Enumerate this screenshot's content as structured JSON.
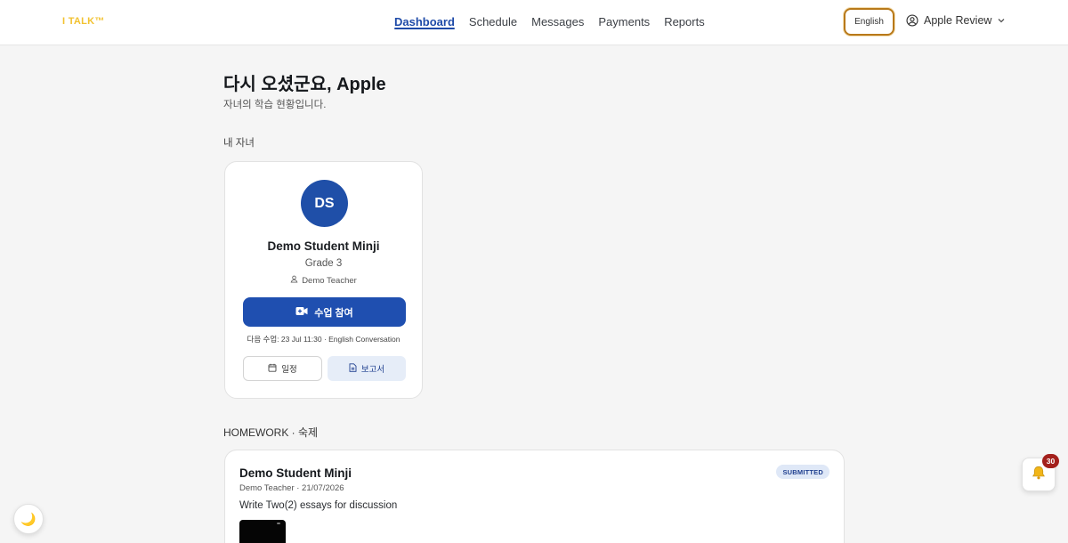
{
  "header": {
    "logo": "I TALK™",
    "nav": [
      {
        "label": "Dashboard"
      },
      {
        "label": "Schedule"
      },
      {
        "label": "Messages"
      },
      {
        "label": "Payments"
      },
      {
        "label": "Reports"
      }
    ],
    "active_nav": "Dashboard",
    "language_button": "English",
    "user_name": "Apple Review",
    "user_icon": "user-circle-icon",
    "menu_icon": "chevron-down-icon"
  },
  "main": {
    "welcome": "다시 오셨군요, Apple",
    "subtitle": "자녀의 학습 현황입니다.",
    "children_label": "내 자녀"
  },
  "child_card": {
    "initials": "DS",
    "name": "Demo Student Minji",
    "grade": "Grade 3",
    "teacher": "Demo Teacher",
    "join_label": "수업 참여",
    "next_class": "다음 수업: 23 Jul 11:30 · English Conversation",
    "schedule_label": "일정",
    "report_label": "보고서",
    "avatar_color": "#1f4fa8"
  },
  "homework": {
    "section_label": "HOMEWORK · 숙제",
    "items": [
      {
        "student": "Demo Student Minji",
        "meta": "Demo Teacher · 21/07/2026",
        "description": "Write Two(2) essays for discussion",
        "status": "SUBMITTED"
      }
    ]
  },
  "floating": {
    "dark_mode_icon": "moon-icon",
    "notification_icon": "bell-icon",
    "notification_count": "30"
  },
  "colors": {
    "accent": "#1e4aa8",
    "logo": "#f2c230",
    "badge": "#a3201c"
  }
}
